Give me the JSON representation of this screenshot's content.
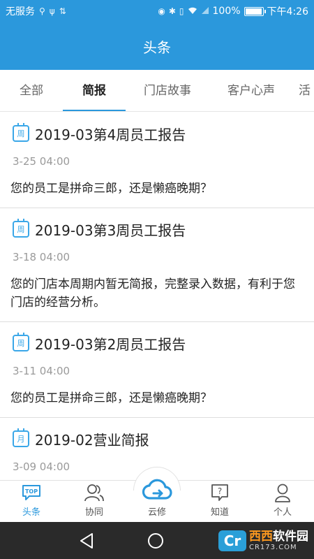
{
  "status": {
    "carrier": "无服务",
    "battery_text": "100%",
    "battery_level": 1.0,
    "time": "下午4:26"
  },
  "header": {
    "title": "头条"
  },
  "tabs": [
    {
      "label": "全部"
    },
    {
      "label": "简报",
      "active": true
    },
    {
      "label": "门店故事"
    },
    {
      "label": "客户心声"
    },
    {
      "label": "活"
    }
  ],
  "items": [
    {
      "icon_char": "周",
      "title": "2019-03第4周员工报告",
      "date": "3-25 04:00",
      "body": "您的员工是拼命三郎，还是懒癌晚期？"
    },
    {
      "icon_char": "周",
      "title": "2019-03第3周员工报告",
      "date": "3-18 04:00",
      "body": "您的门店本周期内暂无简报，完整录入数据，有利于您门店的经营分析。"
    },
    {
      "icon_char": "周",
      "title": "2019-03第2周员工报告",
      "date": "3-11 04:00",
      "body": "您的员工是拼命三郎，还是懒癌晚期？"
    },
    {
      "icon_char": "月",
      "title": "2019-02营业简报",
      "date": "3-09 04:00",
      "body": ""
    }
  ],
  "bottom_nav": [
    {
      "label": "头条",
      "icon": "top-icon",
      "badge": "TOP",
      "active": true
    },
    {
      "label": "协同",
      "icon": "people-icon"
    },
    {
      "label": "云修",
      "icon": "cloud-icon"
    },
    {
      "label": "知道",
      "icon": "question-icon",
      "badge": "?"
    },
    {
      "label": "个人",
      "icon": "person-icon"
    }
  ],
  "watermark": {
    "logo": "Cr",
    "main_a": "西西",
    "main_b": "软件园",
    "sub": "CR173.COM"
  },
  "colors": {
    "primary": "#2b98dc",
    "accent_icon": "#3aa7e8",
    "nav_bar": "#2a2a2a"
  }
}
